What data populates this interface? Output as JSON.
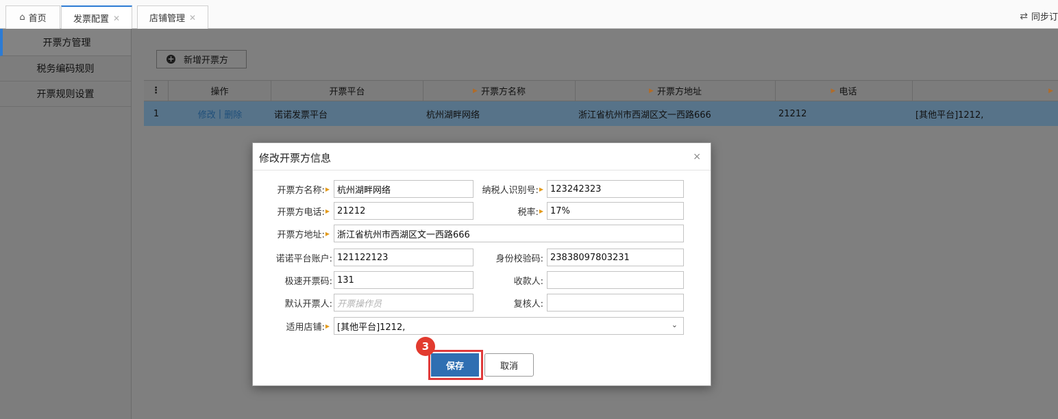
{
  "tabs": [
    {
      "label": "首页",
      "closable": false
    },
    {
      "label": "发票配置",
      "closable": true,
      "active": true
    },
    {
      "label": "店铺管理",
      "closable": true
    }
  ],
  "sync_label": "同步订",
  "sidebar": {
    "items": [
      {
        "label": "开票方管理",
        "active": true
      },
      {
        "label": "税务编码规则"
      },
      {
        "label": "开票规则设置"
      }
    ]
  },
  "toolbar": {
    "add_label": "新增开票方"
  },
  "grid": {
    "columns": [
      "操作",
      "开票平台",
      "开票方名称",
      "开票方地址",
      "电话"
    ],
    "rows": [
      {
        "index": "1",
        "edit": "修改",
        "sep": "|",
        "delete": "删除",
        "platform": "诺诺发票平台",
        "name": "杭州湖畔网络",
        "address": "浙江省杭州市西湖区文一西路666",
        "phone": "21212",
        "store": "[其他平台]1212,"
      }
    ]
  },
  "modal": {
    "title": "修改开票方信息",
    "close": "×",
    "fields": {
      "name": {
        "label": "开票方名称:",
        "value": "杭州湖畔网络"
      },
      "tax_id": {
        "label": "纳税人识别号:",
        "value": "123242323"
      },
      "phone": {
        "label": "开票方电话:",
        "value": "21212"
      },
      "tax_rate": {
        "label": "税率:",
        "value": "17%"
      },
      "address": {
        "label": "开票方地址:",
        "value": "浙江省杭州市西湖区文一西路666"
      },
      "nuonuo_account": {
        "label": "诺诺平台账户:",
        "value": "121122123"
      },
      "id_check": {
        "label": "身份校验码:",
        "value": "23838097803231"
      },
      "fast_code": {
        "label": "极速开票码:",
        "value": "131"
      },
      "payee": {
        "label": "收款人:",
        "value": ""
      },
      "default_issuer": {
        "label": "默认开票人:",
        "value": "",
        "placeholder": "开票操作员"
      },
      "reviewer": {
        "label": "复核人:",
        "value": ""
      },
      "store": {
        "label": "适用店铺:",
        "value": "[其他平台]1212,"
      }
    },
    "save_label": "保存",
    "cancel_label": "取消",
    "step_badge": "3"
  },
  "colors": {
    "accent": "#2c7bd4",
    "save": "#2f6fb2",
    "highlight": "#e03a3a",
    "badge": "#e23b2f",
    "required": "#e39b1d"
  }
}
